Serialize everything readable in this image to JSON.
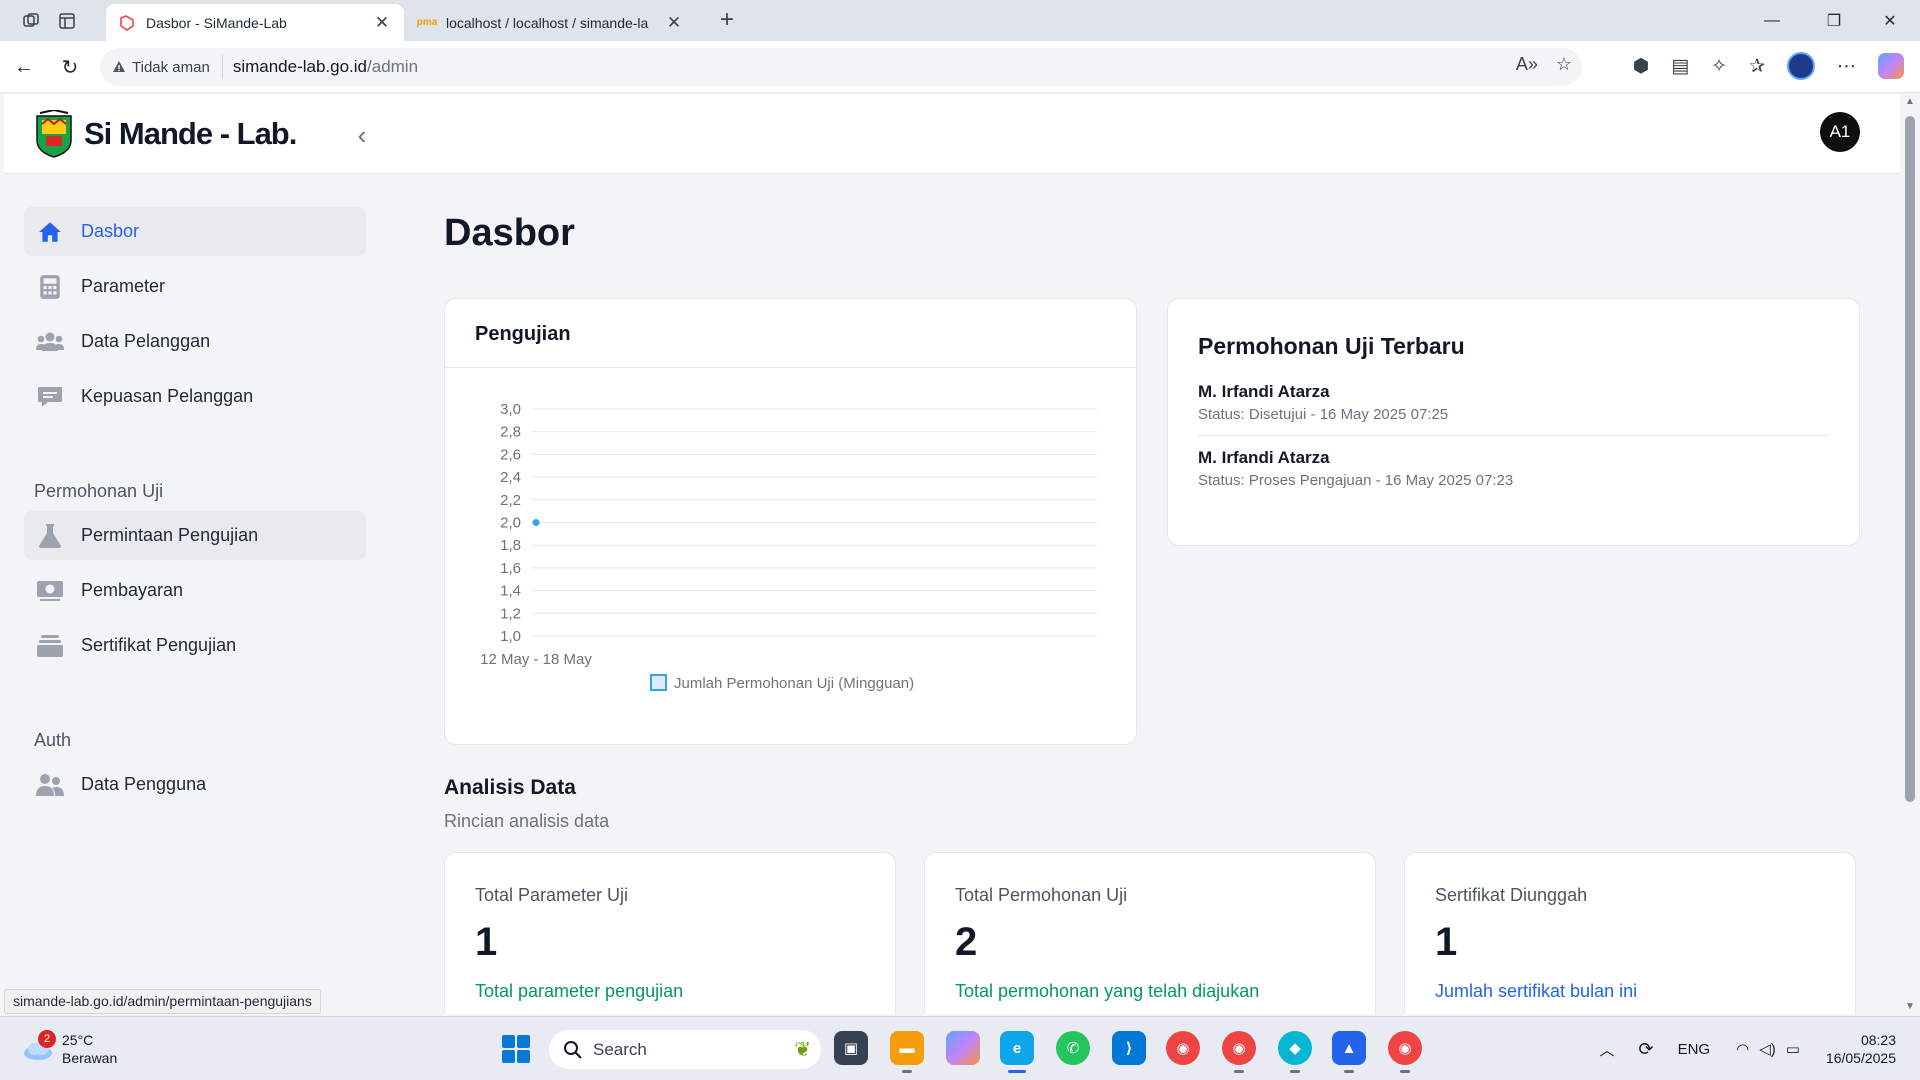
{
  "browser": {
    "tabs": [
      {
        "label": "Dasbor - SiMande-Lab",
        "active": true
      },
      {
        "label": "localhost / localhost / simande-la",
        "active": false
      }
    ],
    "security_label": "Tidak aman",
    "url_host": "simande-lab.go.id",
    "url_path": "/admin",
    "status_link": "simande-lab.go.id/admin/permintaan-pengujians"
  },
  "app": {
    "logo_text": "Si Mande - Lab.",
    "avatar_initials": "A1"
  },
  "sidebar": {
    "items_main": [
      {
        "label": "Dasbor",
        "icon": "home-icon",
        "active": true
      },
      {
        "label": "Parameter",
        "icon": "calculator-icon",
        "active": false
      },
      {
        "label": "Data Pelanggan",
        "icon": "users-icon",
        "active": false
      },
      {
        "label": "Kepuasan Pelanggan",
        "icon": "chat-icon",
        "active": false
      }
    ],
    "section_permohonan": "Permohonan Uji",
    "items_permohonan": [
      {
        "label": "Permintaan Pengujian",
        "icon": "flask-icon"
      },
      {
        "label": "Pembayaran",
        "icon": "money-icon"
      },
      {
        "label": "Sertifikat Pengujian",
        "icon": "archive-icon"
      }
    ],
    "section_auth": "Auth",
    "items_auth": [
      {
        "label": "Data Pengguna",
        "icon": "user-group-icon"
      }
    ]
  },
  "page": {
    "title": "Dasbor"
  },
  "chart_card": {
    "title": "Pengujian"
  },
  "chart_data": {
    "type": "line",
    "categories": [
      "12 May - 18 May"
    ],
    "series": [
      {
        "name": "Jumlah Permohonan Uji (Mingguan)",
        "values": [
          2
        ]
      }
    ],
    "y_ticks": [
      "1,0",
      "1,2",
      "1,4",
      "1,6",
      "1,8",
      "2,0",
      "2,2",
      "2,4",
      "2,6",
      "2,8",
      "3,0"
    ],
    "ylim": [
      1,
      3
    ],
    "grid": true,
    "legend_position": "bottom",
    "color": "#36a2eb"
  },
  "latest": {
    "title": "Permohonan Uji Terbaru",
    "items": [
      {
        "name": "M. Irfandi Atarza",
        "status": "Status: Disetujui - 16 May 2025 07:25"
      },
      {
        "name": "M. Irfandi Atarza",
        "status": "Status: Proses Pengajuan - 16 May 2025 07:23"
      }
    ]
  },
  "analysis": {
    "title": "Analisis Data",
    "subtitle": "Rincian analisis data",
    "stats": [
      {
        "label": "Total Parameter Uji",
        "value": "1",
        "note": "Total parameter pengujian",
        "note_color": "#059669"
      },
      {
        "label": "Total Permohonan Uji",
        "value": "2",
        "note": "Total permohonan yang telah diajukan",
        "note_color": "#059669"
      },
      {
        "label": "Sertifikat Diunggah",
        "value": "1",
        "note": "Jumlah sertifikat bulan ini",
        "note_color": "#2563eb"
      }
    ]
  },
  "taskbar": {
    "weather_temp": "25°C",
    "weather_desc": "Berawan",
    "weather_badge": "2",
    "search_label": "Search",
    "language": "ENG",
    "time": "08:23",
    "date": "16/05/2025"
  }
}
